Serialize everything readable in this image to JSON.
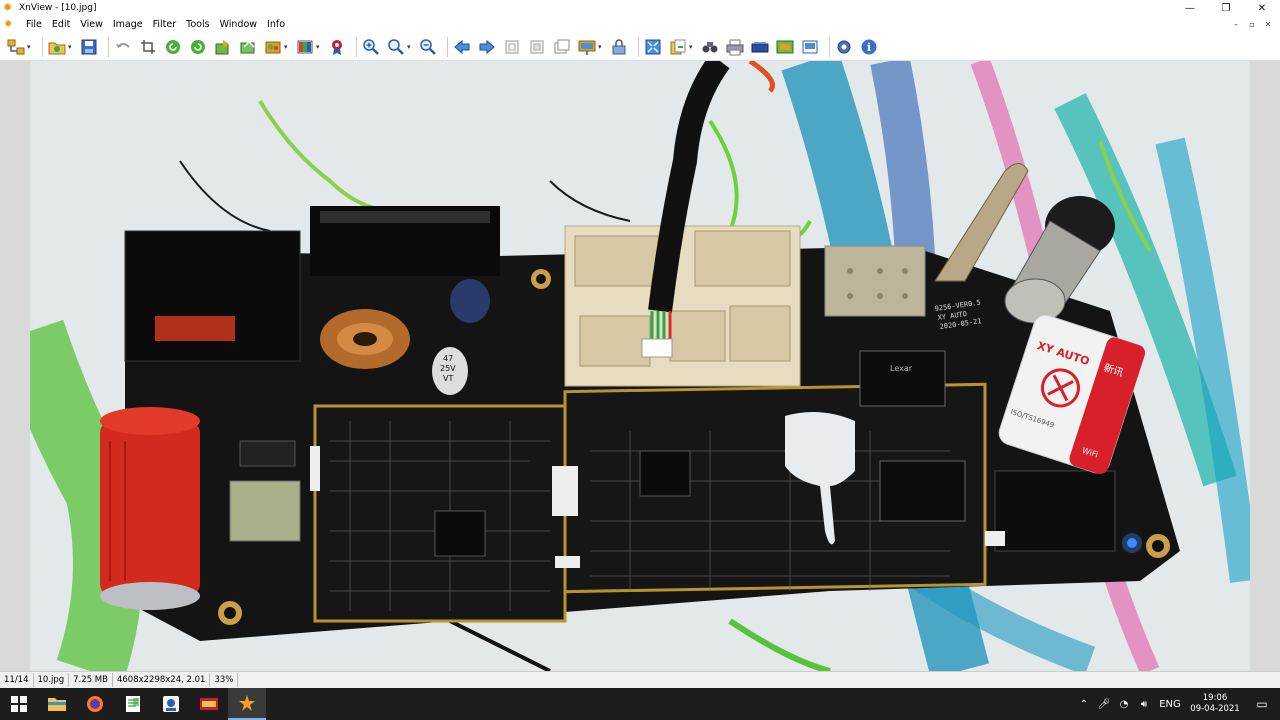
{
  "window": {
    "title": "XnView - [10.jpg]",
    "minimize": "—",
    "maximize": "❐",
    "close": "✕"
  },
  "menu": [
    "File",
    "Edit",
    "View",
    "Image",
    "Filter",
    "Tools",
    "Window",
    "Info"
  ],
  "mdi": {
    "minimize": "–",
    "restore": "▫",
    "close": "✕"
  },
  "toolbar": {
    "icons": [
      "browser-icon",
      "open-folder-icon",
      "save-icon",
      "undo-icon",
      "crop-icon",
      "rotate-left-icon",
      "rotate-right-icon",
      "export-icon",
      "send-icon",
      "batch-icon",
      "adjust-icon",
      "award-icon",
      "zoom-in-icon",
      "zoom-icon",
      "zoom-out-icon",
      "previous-icon",
      "next-icon",
      "first-icon",
      "last-icon",
      "window-icon",
      "slideshow-icon",
      "lock-icon",
      "fullscreen-icon",
      "copy-icon",
      "binoculars-icon",
      "print-icon",
      "scanner-icon",
      "capture-icon",
      "tools-icon",
      "settings-icon",
      "info-icon"
    ]
  },
  "status": {
    "index": "11/14",
    "filename": "10.jpg",
    "filesize": "7.25 MB",
    "dimensions": "4608x2298x24, 2.01",
    "zoom": "33%"
  },
  "photo": {
    "board_text_1": "9256-VER0.5",
    "board_text_2": "XY AUTO",
    "board_text_3": "2020-05-21",
    "cap_text_1": "47",
    "cap_text_2": "25V",
    "cap_text_3": "VT",
    "sticker_brand": "XY AUTO",
    "sticker_cn": "新讯",
    "sticker_iso": "ISO/TS16949",
    "sticker_wifi": "WiFi",
    "chip_label": "Lexar"
  },
  "taskbar": {
    "apps": [
      "explorer-icon",
      "firefox-icon",
      "notepad-icon",
      "app-icon",
      "winrar-icon",
      "xnview-icon"
    ],
    "lang": "ENG",
    "time": "19:06",
    "date": "09-04-2021"
  },
  "colors": {
    "pcb": "#141414",
    "connector": "#e8dcc0",
    "capacitor": "#d22a1c",
    "gold": "#b8942e"
  }
}
